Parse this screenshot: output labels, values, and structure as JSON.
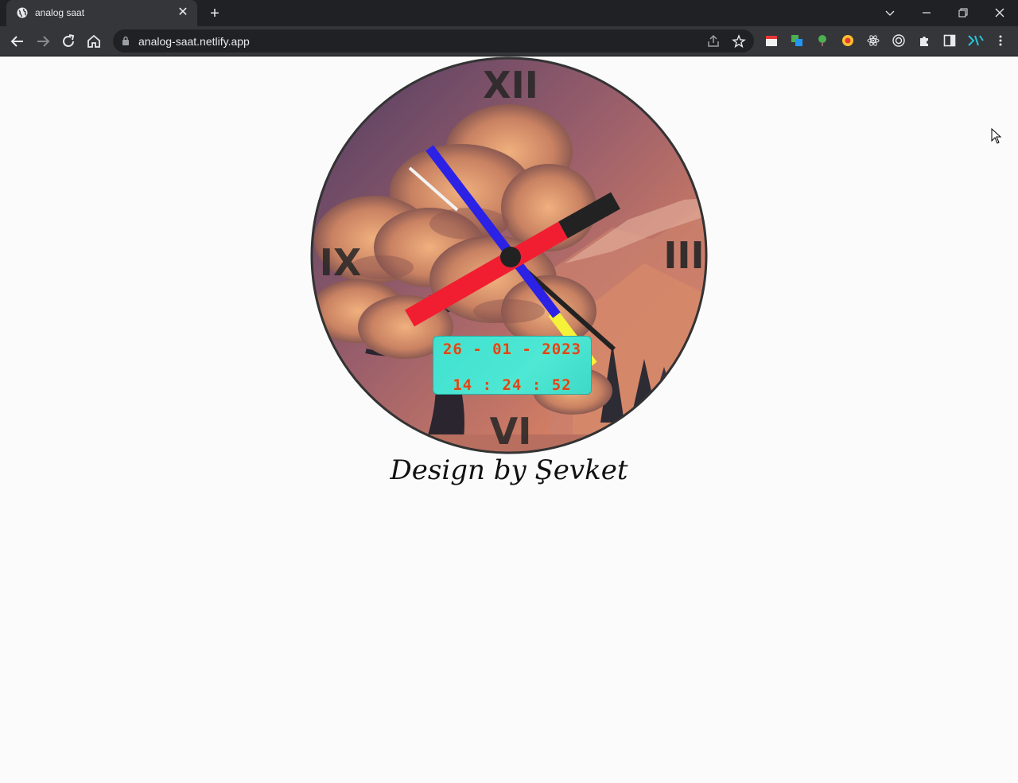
{
  "browser": {
    "tab_title": "analog saat",
    "url": "analog-saat.netlify.app"
  },
  "icons": {
    "favicon": "globe-icon",
    "tab_close": "close-icon",
    "new_tab": "plus-icon",
    "back": "arrow-left-icon",
    "forward": "arrow-right-icon",
    "reload": "reload-icon",
    "home": "home-icon",
    "lock": "lock-icon",
    "share": "share-icon",
    "bookmark": "star-icon",
    "extensions": "puzzle-icon",
    "side_panel": "side-panel-icon",
    "menu": "kebab-menu-icon"
  },
  "clock": {
    "numerals": {
      "twelve": "XII",
      "three": "III",
      "six": "VI",
      "nine": "IX"
    },
    "date": "26 - 01 - 2023",
    "time": "14 : 24 : 52",
    "colors": {
      "hour_hand": "#222222",
      "minute_hand": "#2b22e6",
      "second_hand": "#f01e30",
      "accent": "#f5f23a",
      "display_text": "#d9471c",
      "display_bg": "#40e0d0"
    }
  },
  "credit": "Design by Şevket"
}
